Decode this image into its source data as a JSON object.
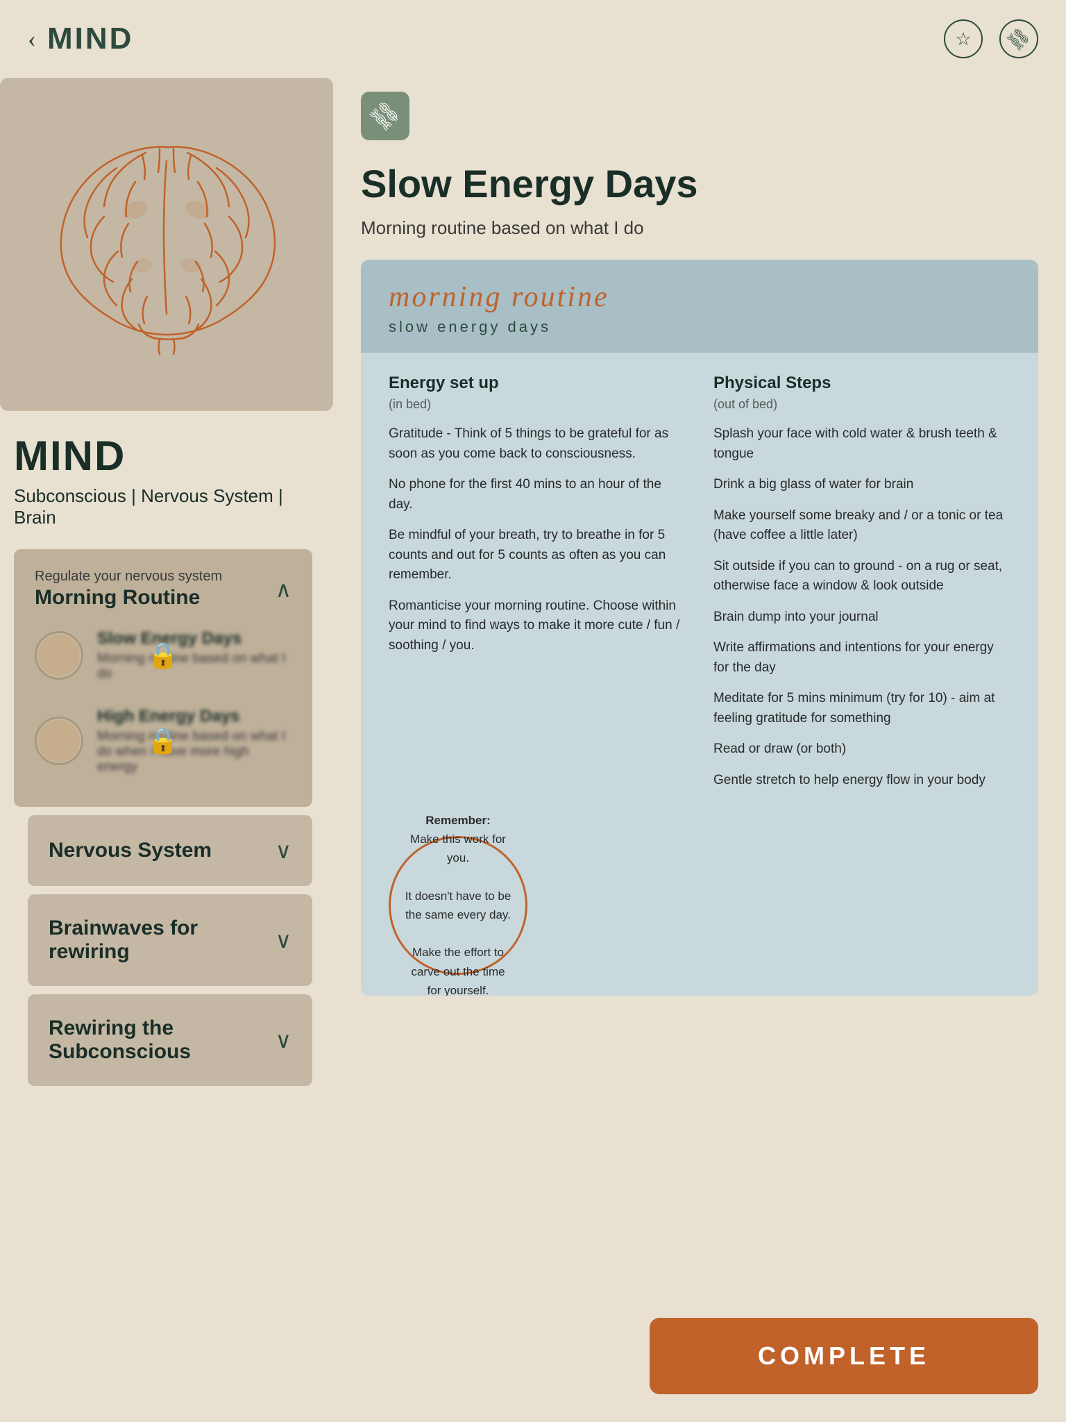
{
  "header": {
    "title": "MIND",
    "back_label": "‹",
    "star_icon": "☆",
    "link_icon": "🔗"
  },
  "brain_image": {
    "alt": "Brain illustration"
  },
  "left_panel": {
    "title": "MIND",
    "subtitle": "Subconscious | Nervous System | Brain",
    "morning_routine": {
      "small_label": "Regulate your nervous system",
      "title": "Morning Routine",
      "expanded": true
    },
    "sub_items": [
      {
        "title": "Slow Energy Days",
        "desc": "Morning routine based on what I do",
        "locked": true
      },
      {
        "title": "High Energy Days",
        "desc": "Morning routine based on what I do when I have more high energy",
        "locked": true
      }
    ],
    "bottom_sections": [
      {
        "title": "Nervous System"
      },
      {
        "title": "Brainwaves for rewiring"
      },
      {
        "title": "Rewiring the Subconscious"
      }
    ]
  },
  "right_panel": {
    "link_icon_label": "🔗",
    "title": "Slow Energy Days",
    "subtitle": "Morning routine based on what I do",
    "card": {
      "title": "morning routine",
      "subtitle": "slow energy days",
      "energy_col": {
        "title": "Energy set up",
        "subtitle": "(in bed)",
        "items": [
          "Gratitude - Think of 5 things to be grateful for as soon as you come back to consciousness.",
          "No phone for the first 40 mins to an hour of the day.",
          "Be mindful of your breath, try to breathe in for 5 counts and out for 5 counts as often as you can remember.",
          "Romanticise your morning routine. Choose within your mind to find ways to make it more cute / fun / soothing / you."
        ]
      },
      "physical_col": {
        "title": "Physical Steps",
        "subtitle": "(out of bed)",
        "items": [
          "Splash your face with cold water & brush teeth & tongue",
          "Drink a big glass of water for brain",
          "Make yourself some breaky and / or a tonic or tea (have coffee a little later)",
          "Sit outside if you can to ground - on a rug or seat, otherwise face a window & look outside",
          "Brain dump into your journal",
          "Write affirmations and intentions for your energy for the day",
          "Meditate for 5 mins minimum (try for 10) - aim at feeling gratitude for something",
          "Read or draw (or both)",
          "Gentle stretch to help energy flow in your body"
        ]
      },
      "remember": {
        "heading": "Remember:",
        "lines": [
          "Make this work for you.",
          "It doesn't have to be the same every day.",
          "Make the effort to carve out the time for yourself."
        ]
      }
    }
  },
  "complete_button": {
    "label": "COMPLETE"
  }
}
